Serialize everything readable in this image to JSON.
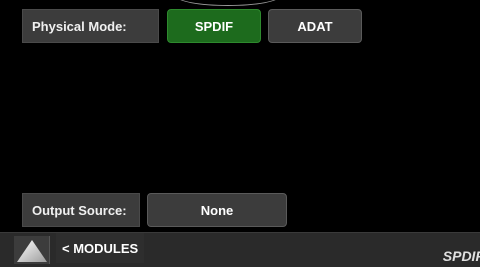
{
  "physical_mode": {
    "label": "Physical Mode:",
    "options": [
      {
        "label": "SPDIF",
        "selected": true
      },
      {
        "label": "ADAT",
        "selected": false
      }
    ],
    "active_color": "#1d6b1d",
    "inactive_color": "#3c3c3c"
  },
  "output_source": {
    "label": "Output Source:",
    "value": "None"
  },
  "footer": {
    "home_icon": "triangle-up-icon",
    "back_label": "< MODULES",
    "status": "SPDIF"
  }
}
